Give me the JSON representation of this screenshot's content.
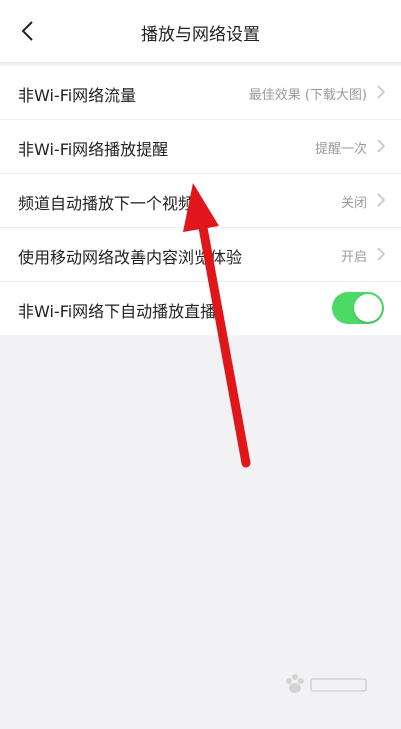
{
  "header": {
    "title": "播放与网络设置",
    "back_icon": "chevron-left-icon"
  },
  "settings": [
    {
      "label": "非Wi-Fi网络流量",
      "value": "最佳效果 (下载大图)",
      "type": "link"
    },
    {
      "label": "非Wi-Fi网络播放提醒",
      "value": "提醒一次",
      "type": "link"
    },
    {
      "label": "频道自动播放下一个视频",
      "value": "关闭",
      "type": "link"
    },
    {
      "label": "使用移动网络改善内容浏览体验",
      "value": "开启",
      "type": "link"
    },
    {
      "label": "非Wi-Fi网络下自动播放直播",
      "type": "toggle",
      "checked": true
    }
  ],
  "colors": {
    "toggle_on": "#4cd964",
    "annotation_arrow": "#e0161b",
    "background": "#f2f2f4"
  }
}
